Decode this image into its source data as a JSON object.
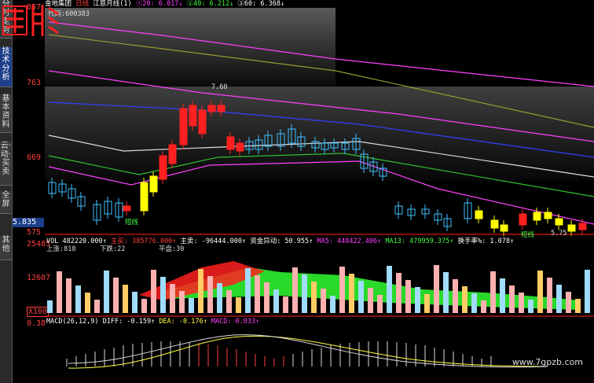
{
  "sidebar": {
    "tabs": [
      {
        "label": "分时走势",
        "active": false
      },
      {
        "label": "技术分析",
        "active": true
      },
      {
        "label": "基本资料",
        "active": false
      },
      {
        "label": "云·动·买卖",
        "active": false
      },
      {
        "label": "全屏",
        "active": false
      },
      {
        "label": "其他",
        "active": false
      }
    ]
  },
  "price_axis": {
    "ticks": [
      "857",
      "763",
      "669",
      "575"
    ],
    "current_value": "5.835",
    "vol_ticks": [
      "25485",
      "12607",
      "X100",
      "0.38"
    ]
  },
  "header": {
    "stock_name": "金地集团",
    "period": "日线",
    "indicator": "江恩月线(1)",
    "ma20": "①20: 6.017↓",
    "ma40": "②40: 6.212↓",
    "ma60": "③60: 6.368↓",
    "code": "代码:600383",
    "annotation_high": "7.60",
    "short_line_1": "短线",
    "short_line_2": "短线",
    "low_annotation": "5.75"
  },
  "volume_panel": {
    "line1": [
      {
        "text": "VOL 482220.000↑",
        "color": "#ffffff"
      },
      {
        "text": "主买: 385776.000↑",
        "color": "#ff4040"
      },
      {
        "text": "主卖: -96444.000↑",
        "color": "#ffffff"
      },
      {
        "text": "资金异动: 50.955↑",
        "color": "#ffffff"
      },
      {
        "text": "MA5: 448422.406↑",
        "color": "#ff40ff"
      },
      {
        "text": "MA13: 479959.375↑",
        "color": "#40ff40"
      },
      {
        "text": "换手率%: 1.078↑",
        "color": "#ffffff"
      },
      {
        "text": "448422.406↑",
        "color": "#ff40ff"
      },
      {
        "text": "448422.406↑",
        "color": "#ff40ff"
      }
    ],
    "line2_a": "上涨:818",
    "line2_b": "下跌:22",
    "line2_c": "平盘:30"
  },
  "macd_panel": {
    "label": "MACD(26,12,9)",
    "diff": "DIFF: -0.159↑",
    "dea": "DEA: -0.176↑",
    "macd": "MACD: 0.033↑"
  },
  "watermark": "www.7gpzb.com",
  "colors": {
    "up": "#ff2020",
    "down": "#40c0ff",
    "yellow": "#ffff00",
    "background": "#000000"
  }
}
